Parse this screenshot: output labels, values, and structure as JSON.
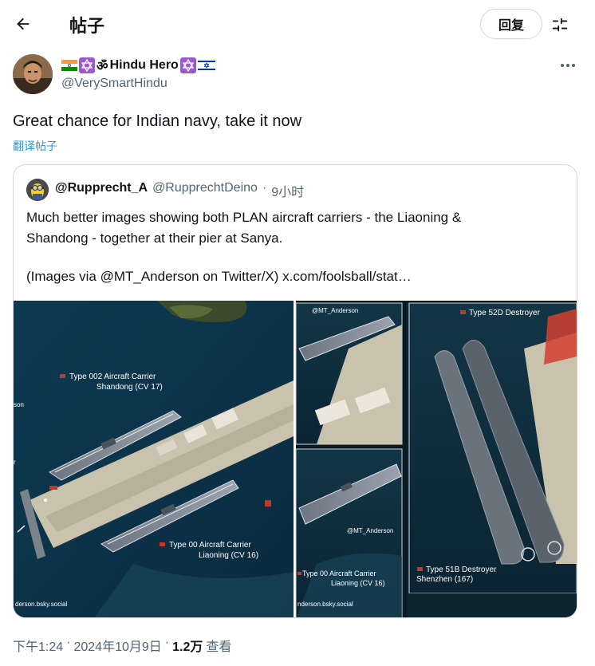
{
  "header": {
    "title": "帖子",
    "reply_label": "回复"
  },
  "author": {
    "display_name": "Hindu Hero",
    "handle": "@VerySmartHindu"
  },
  "post": {
    "text": "Great chance for Indian navy, take it now",
    "translate_label": "翻译帖子"
  },
  "quote": {
    "name": "@Rupprecht_A",
    "handle": "@RupprechtDeino",
    "dot": "·",
    "time": "9小时",
    "line1": "Much better images showing both PLAN aircraft carriers - the Liaoning &",
    "line2": "Shandong - together at their pier at Sanya.",
    "line3": "(Images via @MT_Anderson on Twitter/X)  x.com/foolsball/stat…"
  },
  "media": {
    "left": {
      "label_shandong_1": "Type 002 Aircraft Carrier",
      "label_shandong_2": "Shandong (CV 17)",
      "label_liaoning_1": "Type 00 Aircraft Carrier",
      "label_liaoning_2": "Liaoning (CV 16)",
      "edge_son": "son",
      "edge_r": "r",
      "credit": "derson.bsky.social"
    },
    "top_mid_credit": "@MT_Anderson",
    "bottom_mid": {
      "credit": "@MT_Anderson",
      "label_1": "Type 00 Aircraft Carrier",
      "label_2": "Liaoning (CV 16)",
      "credit_bottom": "nderson.bsky.social"
    },
    "right": {
      "label_top": "Type 52D Destroyer",
      "label_bottom_1": "Type 51B Destroyer",
      "label_bottom_2": "Shenzhen (167)"
    }
  },
  "meta": {
    "time": "下午1:24",
    "sep1": "·",
    "date": "2024年10月9日",
    "sep2": "·",
    "views": "1.2万",
    "views_label": "查看"
  }
}
